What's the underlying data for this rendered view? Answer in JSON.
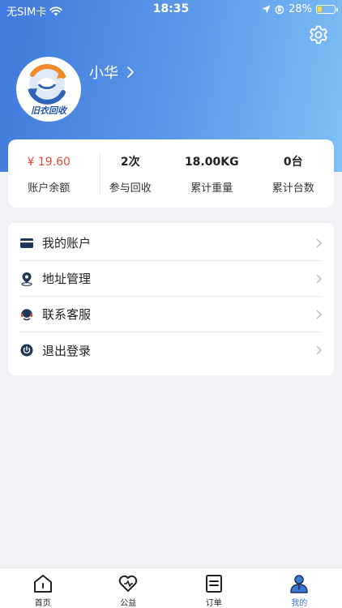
{
  "status_bar": {
    "carrier": "无SIM卡",
    "time": "18:35",
    "battery": "28%",
    "battery_level": 0.28
  },
  "header": {
    "settings_icon": "gear-icon"
  },
  "profile": {
    "avatar_caption": "旧衣回收",
    "name": "小华"
  },
  "stats": [
    {
      "value": "¥ 19.60",
      "label": "账户余额"
    },
    {
      "value": "2次",
      "label": "参与回收"
    },
    {
      "value": "18.00KG",
      "label": "累计重量"
    },
    {
      "value": "0台",
      "label": "累计台数"
    }
  ],
  "menu": [
    {
      "label": "我的账户",
      "icon": "card-icon"
    },
    {
      "label": "地址管理",
      "icon": "location-pin-icon"
    },
    {
      "label": "联系客服",
      "icon": "headset-icon"
    },
    {
      "label": "退出登录",
      "icon": "power-icon"
    }
  ],
  "tabs": [
    {
      "label": "首页",
      "icon": "home-icon",
      "active": false
    },
    {
      "label": "公益",
      "icon": "heart-icon",
      "active": false
    },
    {
      "label": "订单",
      "icon": "order-icon",
      "active": false
    },
    {
      "label": "我的",
      "icon": "user-icon",
      "active": true
    }
  ],
  "colors": {
    "header_gradient_start": "#3f79dd",
    "header_gradient_end": "#7ec0f7",
    "money": "#e14a3a",
    "accent": "#3b78d8"
  }
}
